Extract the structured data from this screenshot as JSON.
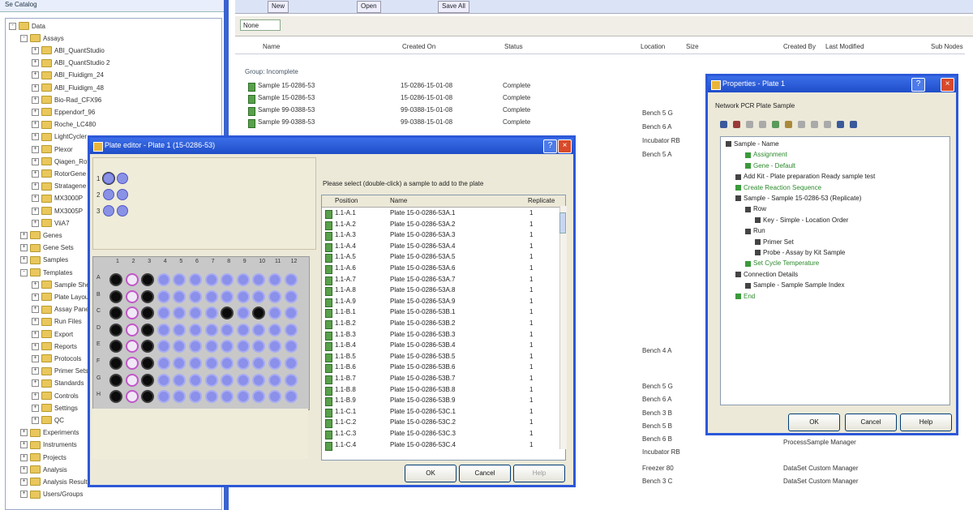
{
  "left_panel": {
    "header": "Se Catalog",
    "tree": [
      {
        "label": "Data",
        "indent": 0,
        "exp": "-"
      },
      {
        "label": "Assays",
        "indent": 1,
        "exp": "-"
      },
      {
        "label": "ABI_QuantStudio",
        "indent": 2,
        "exp": "+"
      },
      {
        "label": "ABI_QuantStudio 2",
        "indent": 2,
        "exp": "+"
      },
      {
        "label": "ABI_Fluidigm_24",
        "indent": 2,
        "exp": "+"
      },
      {
        "label": "ABI_Fluidigm_48",
        "indent": 2,
        "exp": "+"
      },
      {
        "label": "Bio-Rad_CFX96",
        "indent": 2,
        "exp": "+"
      },
      {
        "label": "Eppendorf_96",
        "indent": 2,
        "exp": "+"
      },
      {
        "label": "Roche_LC480",
        "indent": 2,
        "exp": "+"
      },
      {
        "label": "LightCycler",
        "indent": 2,
        "exp": "+"
      },
      {
        "label": "Plexor",
        "indent": 2,
        "exp": "+"
      },
      {
        "label": "Qiagen_Rotor",
        "indent": 2,
        "exp": "+"
      },
      {
        "label": "RotorGene",
        "indent": 2,
        "exp": "+"
      },
      {
        "label": "Stratagene",
        "indent": 2,
        "exp": "+"
      },
      {
        "label": "MX3000P",
        "indent": 2,
        "exp": "+"
      },
      {
        "label": "MX3005P",
        "indent": 2,
        "exp": "+"
      },
      {
        "label": "ViiA7",
        "indent": 2,
        "exp": "+"
      },
      {
        "label": "Genes",
        "indent": 1,
        "exp": "+"
      },
      {
        "label": "Gene Sets",
        "indent": 1,
        "exp": "+"
      },
      {
        "label": "Samples",
        "indent": 1,
        "exp": "+"
      },
      {
        "label": "Templates",
        "indent": 1,
        "exp": "-"
      },
      {
        "label": "Sample Sheets",
        "indent": 2,
        "exp": "+"
      },
      {
        "label": "Plate Layouts",
        "indent": 2,
        "exp": "+"
      },
      {
        "label": "Assay Panels",
        "indent": 2,
        "exp": "+"
      },
      {
        "label": "Run Files",
        "indent": 2,
        "exp": "+"
      },
      {
        "label": "Export",
        "indent": 2,
        "exp": "+"
      },
      {
        "label": "Reports",
        "indent": 2,
        "exp": "+"
      },
      {
        "label": "Protocols",
        "indent": 2,
        "exp": "+"
      },
      {
        "label": "Primer Sets",
        "indent": 2,
        "exp": "+"
      },
      {
        "label": "Standards",
        "indent": 2,
        "exp": "+"
      },
      {
        "label": "Controls",
        "indent": 2,
        "exp": "+"
      },
      {
        "label": "Settings",
        "indent": 2,
        "exp": "+"
      },
      {
        "label": "QC",
        "indent": 2,
        "exp": "+"
      },
      {
        "label": "Experiments",
        "indent": 1,
        "exp": "+"
      },
      {
        "label": "Instruments",
        "indent": 1,
        "exp": "+"
      },
      {
        "label": "Projects",
        "indent": 1,
        "exp": "+"
      },
      {
        "label": "Analysis",
        "indent": 1,
        "exp": "+"
      },
      {
        "label": "Analysis Results",
        "indent": 1,
        "exp": "+"
      },
      {
        "label": "Users/Groups",
        "indent": 1,
        "exp": "+"
      }
    ]
  },
  "toolbar": {
    "buttons": [
      "New",
      "Open",
      "Save All"
    ]
  },
  "filter": {
    "value": "None"
  },
  "columns": [
    "Name",
    "Created On",
    "Status",
    "Location",
    "Size",
    "Created By",
    "Last Modified",
    "Sub Nodes"
  ],
  "group_label": "Group: Incomplete",
  "bg_rows": [
    {
      "name": "Sample 15-0286-53",
      "date": "15-0286-15-01-08",
      "status": "Complete"
    },
    {
      "name": "Sample 15-0286-53",
      "date": "15-0286-15-01-08",
      "status": "Complete"
    },
    {
      "name": "Sample 99-0388-53",
      "date": "99-0388-15-01-08",
      "status": "Complete"
    },
    {
      "name": "Sample 99-0388-53",
      "date": "99-0388-15-01-08",
      "status": "Complete"
    }
  ],
  "side_texts": [
    "Bench 5 G",
    "Bench 6 A",
    "Incubator RB",
    "Bench 5 A",
    "Bench 4 A",
    "Bench 5 G",
    "Bench 6 A",
    "Bench 3 B",
    "Bench 5 B",
    "Bench 6 B",
    "Incubator RB",
    "Freezer 80",
    "Bench 3 C"
  ],
  "right_texts": [
    "ProcessSample Manager",
    "DataSet Custom Manager",
    "DataSet Custom Manager"
  ],
  "plate_dialog": {
    "title": "Plate editor - Plate 1 (15-0286-53)",
    "message": "Please select (double-click) a sample to add to the plate",
    "list_columns": [
      "Position",
      "Name",
      "Replicate"
    ],
    "rows": [
      {
        "pos": "1.1-A.1",
        "name": "Plate 15-0-0286-53A.1",
        "rep": "1"
      },
      {
        "pos": "1.1-A.2",
        "name": "Plate 15-0-0286-53A.2",
        "rep": "1"
      },
      {
        "pos": "1.1-A.3",
        "name": "Plate 15-0-0286-53A.3",
        "rep": "1"
      },
      {
        "pos": "1.1-A.4",
        "name": "Plate 15-0-0286-53A.4",
        "rep": "1"
      },
      {
        "pos": "1.1-A.5",
        "name": "Plate 15-0-0286-53A.5",
        "rep": "1"
      },
      {
        "pos": "1.1-A.6",
        "name": "Plate 15-0-0286-53A.6",
        "rep": "1"
      },
      {
        "pos": "1.1-A.7",
        "name": "Plate 15-0-0286-53A.7",
        "rep": "1"
      },
      {
        "pos": "1.1-A.8",
        "name": "Plate 15-0-0286-53A.8",
        "rep": "1"
      },
      {
        "pos": "1.1-A.9",
        "name": "Plate 15-0-0286-53A.9",
        "rep": "1"
      },
      {
        "pos": "1.1-B.1",
        "name": "Plate 15-0-0286-53B.1",
        "rep": "1"
      },
      {
        "pos": "1.1-B.2",
        "name": "Plate 15-0-0286-53B.2",
        "rep": "1"
      },
      {
        "pos": "1.1-B.3",
        "name": "Plate 15-0-0286-53B.3",
        "rep": "1"
      },
      {
        "pos": "1.1-B.4",
        "name": "Plate 15-0-0286-53B.4",
        "rep": "1"
      },
      {
        "pos": "1.1-B.5",
        "name": "Plate 15-0-0286-53B.5",
        "rep": "1"
      },
      {
        "pos": "1.1-B.6",
        "name": "Plate 15-0-0286-53B.6",
        "rep": "1"
      },
      {
        "pos": "1.1-B.7",
        "name": "Plate 15-0-0286-53B.7",
        "rep": "1"
      },
      {
        "pos": "1.1-B.8",
        "name": "Plate 15-0-0286-53B.8",
        "rep": "1"
      },
      {
        "pos": "1.1-B.9",
        "name": "Plate 15-0-0286-53B.9",
        "rep": "1"
      },
      {
        "pos": "1.1-C.1",
        "name": "Plate 15-0-0286-53C.1",
        "rep": "1"
      },
      {
        "pos": "1.1-C.2",
        "name": "Plate 15-0-0286-53C.2",
        "rep": "1"
      },
      {
        "pos": "1.1-C.3",
        "name": "Plate 15-0-0286-53C.3",
        "rep": "1"
      },
      {
        "pos": "1.1-C.4",
        "name": "Plate 15-0-0286-53C.4",
        "rep": "1"
      }
    ],
    "ok": "OK",
    "cancel": "Cancel",
    "help": "Help"
  },
  "plate": {
    "cols": [
      "1",
      "2",
      "3",
      "4",
      "5",
      "6",
      "7",
      "8",
      "9",
      "10",
      "11",
      "12"
    ],
    "rows": [
      "A",
      "B",
      "C",
      "D",
      "E",
      "F",
      "G",
      "H"
    ],
    "filled": [
      [
        1,
        0,
        1,
        0,
        0,
        0,
        0,
        0,
        0,
        0,
        0,
        0
      ],
      [
        1,
        0,
        1,
        0,
        0,
        0,
        0,
        0,
        0,
        0,
        0,
        0
      ],
      [
        1,
        0,
        1,
        0,
        0,
        0,
        0,
        1,
        0,
        1,
        0,
        0
      ],
      [
        1,
        0,
        1,
        0,
        0,
        0,
        0,
        0,
        0,
        0,
        0,
        0
      ],
      [
        1,
        0,
        1,
        0,
        0,
        0,
        0,
        0,
        0,
        0,
        0,
        0
      ],
      [
        1,
        0,
        1,
        0,
        0,
        0,
        0,
        0,
        0,
        0,
        0,
        0
      ],
      [
        1,
        0,
        1,
        0,
        0,
        0,
        0,
        0,
        0,
        0,
        0,
        0
      ],
      [
        1,
        0,
        1,
        0,
        0,
        0,
        0,
        0,
        0,
        0,
        0,
        0
      ]
    ],
    "control_col": 1,
    "colors": {
      "empty": "#8b90ea",
      "filled": "#0b0b0b",
      "control": "#c257c9"
    }
  },
  "legend": {
    "rows": [
      "1",
      "2",
      "3"
    ]
  },
  "prop_dialog": {
    "title": "Properties - Plate 1",
    "tabs_text": "Network   PCR   Plate   Sample",
    "tree": [
      {
        "text": "Sample - Name",
        "indent": 0,
        "color": "black"
      },
      {
        "text": "Assignment",
        "indent": 2,
        "color": "green"
      },
      {
        "text": "Gene - Default",
        "indent": 2,
        "color": "green"
      },
      {
        "text": "Add Kit - Plate preparation Ready sample test",
        "indent": 1,
        "color": "black"
      },
      {
        "text": "Create Reaction Sequence",
        "indent": 1,
        "color": "green"
      },
      {
        "text": "Sample - Sample 15-0286-53 (Replicate)",
        "indent": 1,
        "color": "black"
      },
      {
        "text": "Row",
        "indent": 2,
        "color": "black"
      },
      {
        "text": "Key - Simple - Location Order",
        "indent": 3,
        "color": "black"
      },
      {
        "text": "Run",
        "indent": 2,
        "color": "black"
      },
      {
        "text": "Primer Set",
        "indent": 3,
        "color": "black"
      },
      {
        "text": "Probe - Assay by Kit Sample",
        "indent": 3,
        "color": "black"
      },
      {
        "text": "Set Cycle Temperature",
        "indent": 2,
        "color": "green"
      },
      {
        "text": "Connection Details",
        "indent": 1,
        "color": "black"
      },
      {
        "text": "Sample - Sample Sample Index",
        "indent": 2,
        "color": "black"
      },
      {
        "text": "End",
        "indent": 1,
        "color": "green"
      }
    ],
    "ok": "OK",
    "cancel": "Cancel",
    "help": "Help"
  }
}
